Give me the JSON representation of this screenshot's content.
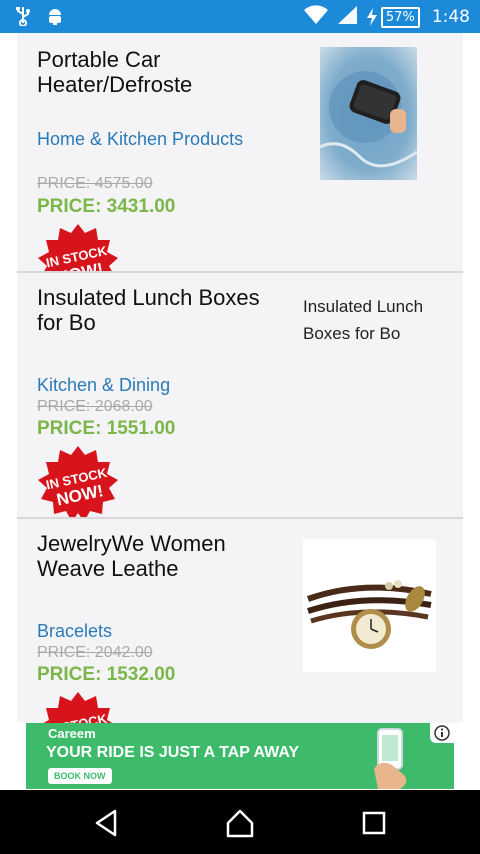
{
  "status_bar": {
    "battery": "57%",
    "time": "1:48",
    "icons": [
      "usb-icon",
      "android-debug-icon",
      "wifi-icon",
      "cell-signal-icon",
      "charging-bolt-icon",
      "battery-icon"
    ]
  },
  "products": [
    {
      "title": "Portable Car Heater/Defroste",
      "category": "Home & Kitchen Products",
      "old_price": "PRICE: 4575.00",
      "price": "PRICE: 3431.00",
      "image": "car-heater-image"
    },
    {
      "title": "Insulated Lunch Boxes for Bo",
      "image_alt": "Insulated Lunch Boxes for Bo",
      "category": "Kitchen & Dining",
      "old_price": "PRICE: 2068.00",
      "price": "PRICE: 1551.00",
      "badge": "IN STOCK NOW!"
    },
    {
      "title": "JewelryWe Women Weave Leathe",
      "category": "Bracelets",
      "old_price": "PRICE: 2042.00",
      "price": "PRICE: 1532.00",
      "image": "bracelet-watch-image"
    }
  ],
  "badge": {
    "line1": "IN STOCK",
    "line2": "NOW!"
  },
  "ad": {
    "brand": "Careem",
    "headline": "YOUR RIDE IS JUST A TAP AWAY",
    "cta": "BOOK NOW"
  },
  "colors": {
    "status_bar": "#1c8ad8",
    "category": "#2a7ab8",
    "price": "#7ab648",
    "badge": "#d7141c",
    "ad": "#3dbb6a"
  }
}
